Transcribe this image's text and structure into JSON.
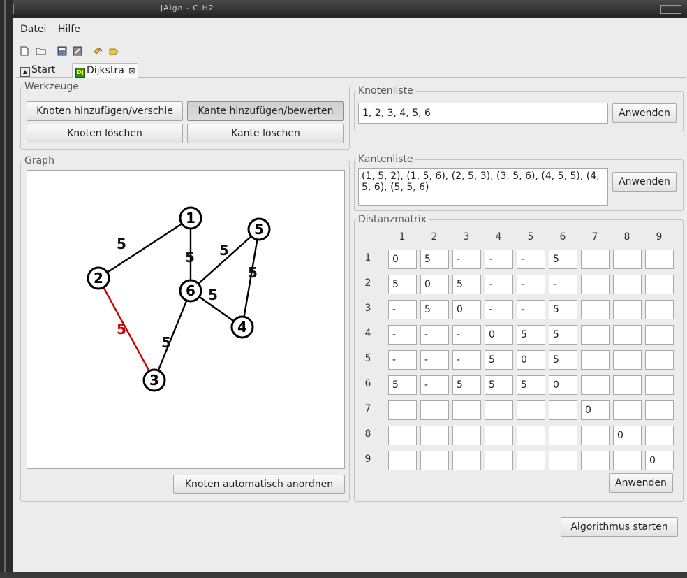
{
  "window": {
    "title": "jAlgo - C.H2"
  },
  "menu": {
    "items": [
      "Datei",
      "Hilfe"
    ]
  },
  "toolbar": {
    "icons": [
      "new-file-icon",
      "open-folder-icon",
      "save-icon",
      "save-as-icon",
      "plugin-icon",
      "plugin-remove-icon"
    ]
  },
  "tabs": [
    {
      "label": "Start",
      "icon": "start-icon"
    },
    {
      "label": "Dijkstra",
      "icon": "dijkstra-icon",
      "close": "⊠"
    }
  ],
  "tools": {
    "legend": "Werkzeuge",
    "buttons": [
      "Knoten hinzufügen/verschie",
      "Kante hinzufügen/bewerten",
      "Knoten löschen",
      "Kante löschen"
    ],
    "active_index": 1
  },
  "graph": {
    "legend": "Graph",
    "arrange_label": "Knoten automatisch anordnen",
    "nodes": [
      {
        "id": "1",
        "label": "1"
      },
      {
        "id": "2",
        "label": "2"
      },
      {
        "id": "3",
        "label": "3"
      },
      {
        "id": "4",
        "label": "4"
      },
      {
        "id": "5",
        "label": "5"
      },
      {
        "id": "6",
        "label": "6"
      }
    ],
    "edges": [
      {
        "from": "1",
        "to": "2",
        "weight": "5",
        "color": "#000000"
      },
      {
        "from": "1",
        "to": "6",
        "weight": "5",
        "color": "#000000"
      },
      {
        "from": "2",
        "to": "3",
        "weight": "5",
        "color": "#cc0000"
      },
      {
        "from": "3",
        "to": "6",
        "weight": "5",
        "color": "#000000"
      },
      {
        "from": "4",
        "to": "5",
        "weight": "5",
        "color": "#000000"
      },
      {
        "from": "4",
        "to": "6",
        "weight": "5",
        "color": "#000000"
      },
      {
        "from": "5",
        "to": "6",
        "weight": "5",
        "color": "#000000"
      }
    ]
  },
  "nodelist": {
    "legend": "Knotenliste",
    "value": "1, 2, 3, 4, 5, 6",
    "apply": "Anwenden"
  },
  "edgelist": {
    "legend": "Kantenliste",
    "value": "(1, 5, 2), (1, 5, 6), (2, 5, 3), (3, 5, 6), (4, 5, 5), (4, 5, 6), (5, 5, 6)",
    "apply": "Anwenden"
  },
  "matrix": {
    "legend": "Distanzmatrix",
    "headers": [
      "1",
      "2",
      "3",
      "4",
      "5",
      "6",
      "7",
      "8",
      "9"
    ],
    "rows": [
      [
        "0",
        "5",
        "-",
        "-",
        "-",
        "5",
        "",
        "",
        ""
      ],
      [
        "5",
        "0",
        "5",
        "-",
        "-",
        "-",
        "",
        "",
        ""
      ],
      [
        "-",
        "5",
        "0",
        "-",
        "-",
        "5",
        "",
        "",
        ""
      ],
      [
        "-",
        "-",
        "-",
        "0",
        "5",
        "5",
        "",
        "",
        ""
      ],
      [
        "-",
        "-",
        "-",
        "5",
        "0",
        "5",
        "",
        "",
        ""
      ],
      [
        "5",
        "-",
        "5",
        "5",
        "5",
        "0",
        "",
        "",
        ""
      ],
      [
        "",
        "",
        "",
        "",
        "",
        "",
        "0",
        "",
        ""
      ],
      [
        "",
        "",
        "",
        "",
        "",
        "",
        "",
        "0",
        ""
      ],
      [
        "",
        "",
        "",
        "",
        "",
        "",
        "",
        "",
        "0"
      ]
    ],
    "apply": "Anwenden"
  },
  "start_button": "Algorithmus starten"
}
